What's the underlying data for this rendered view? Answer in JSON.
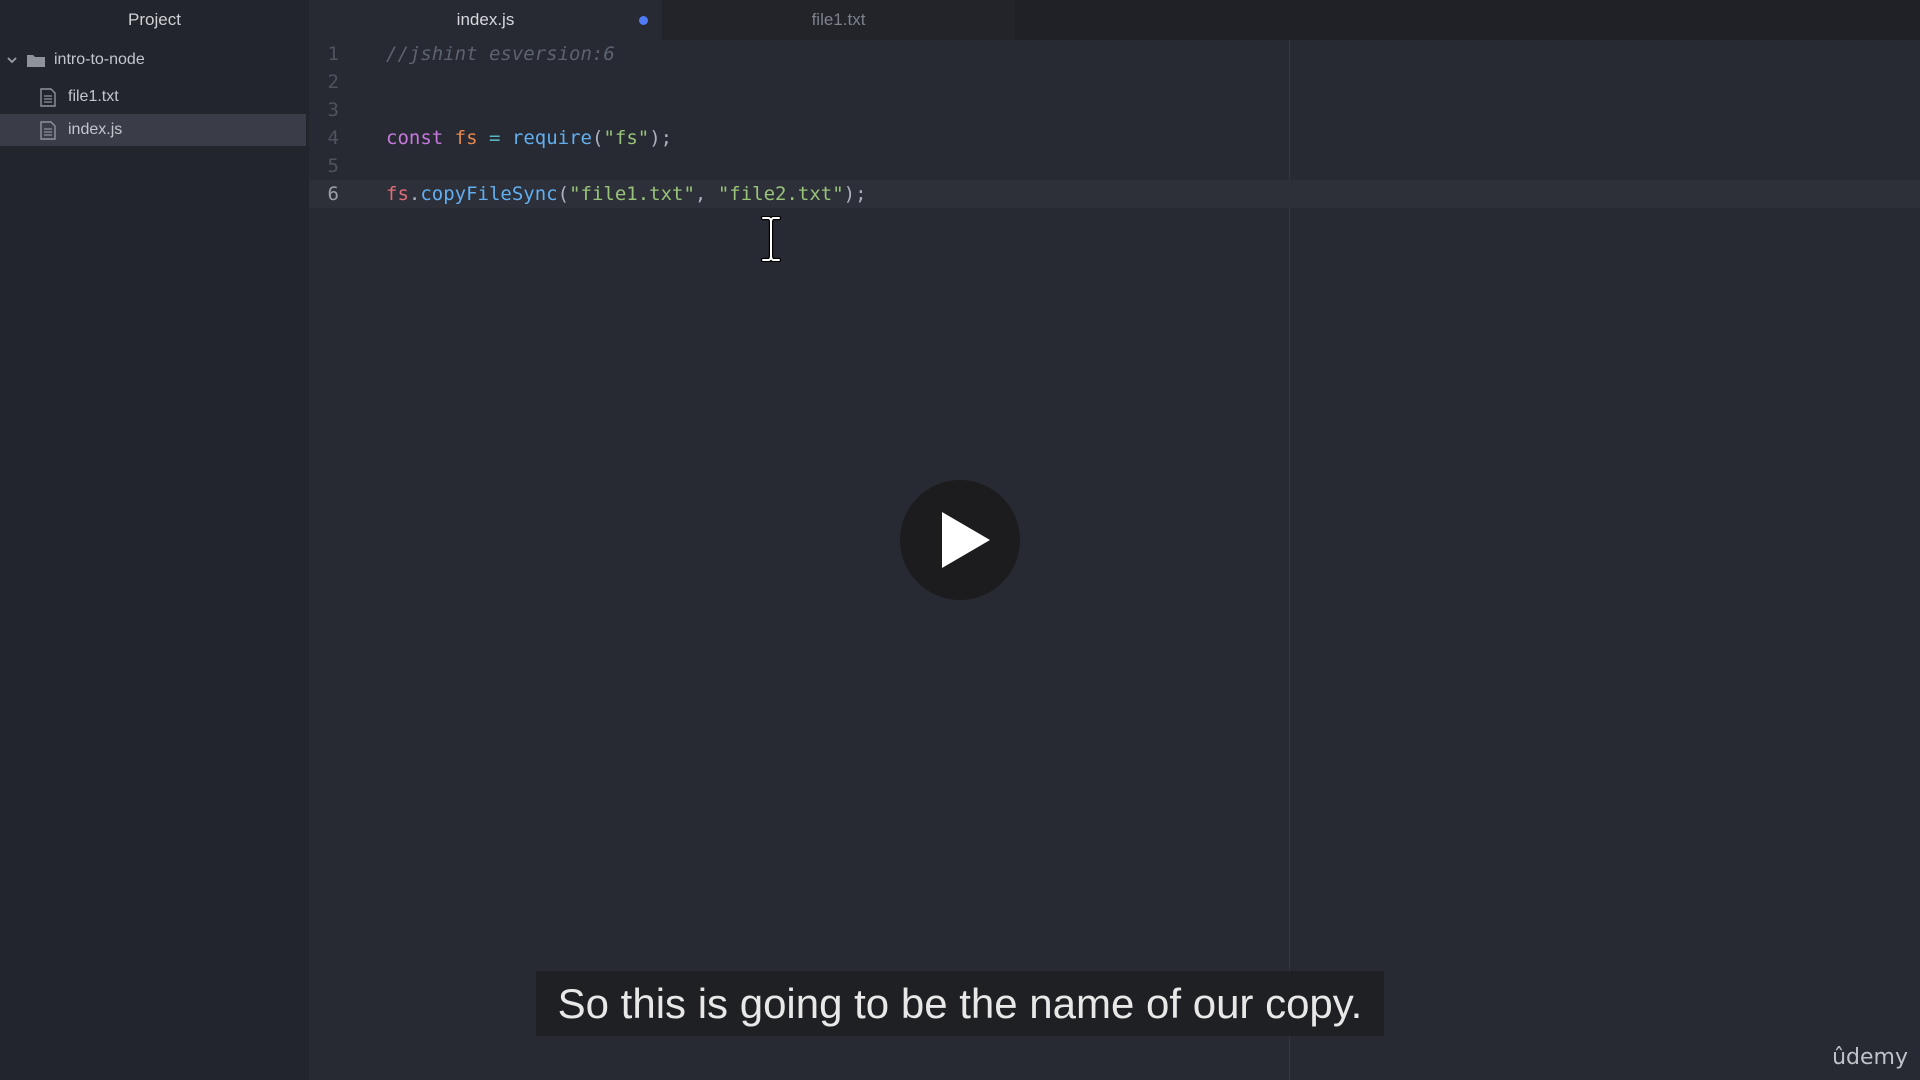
{
  "sidebar": {
    "title": "Project",
    "folder": {
      "label": "intro-to-node",
      "icon": "folder-icon"
    },
    "files": [
      {
        "label": "file1.txt",
        "icon": "file-icon",
        "selected": false
      },
      {
        "label": "index.js",
        "icon": "file-icon",
        "selected": true
      }
    ]
  },
  "tabs": [
    {
      "label": "index.js",
      "active": true,
      "modified": true
    },
    {
      "label": "file1.txt",
      "active": false,
      "modified": false
    }
  ],
  "editor": {
    "line_numbers": [
      "1",
      "2",
      "3",
      "4",
      "5",
      "6"
    ],
    "current_line": "6",
    "lines": {
      "l1": {
        "comment": "//jshint esversion:6"
      },
      "l4": {
        "kw": "const",
        "var": "fs",
        "op": "=",
        "func": "require",
        "open": "(",
        "str": "\"fs\"",
        "close": ");"
      },
      "l6": {
        "obj": "fs",
        "dot": ".",
        "func": "copyFileSync",
        "open": "(",
        "str1": "\"file1.txt\"",
        "comma": ", ",
        "str2": "\"file2.txt\"",
        "close": ");"
      }
    }
  },
  "video": {
    "play_icon": "play-icon",
    "caption": "So this is going to be the name of our copy.",
    "logo": "ûdemy"
  },
  "colors": {
    "accent_dot": "#4f7cf5",
    "editor_bg": "#282a33",
    "sidebar_bg": "#23252c"
  }
}
